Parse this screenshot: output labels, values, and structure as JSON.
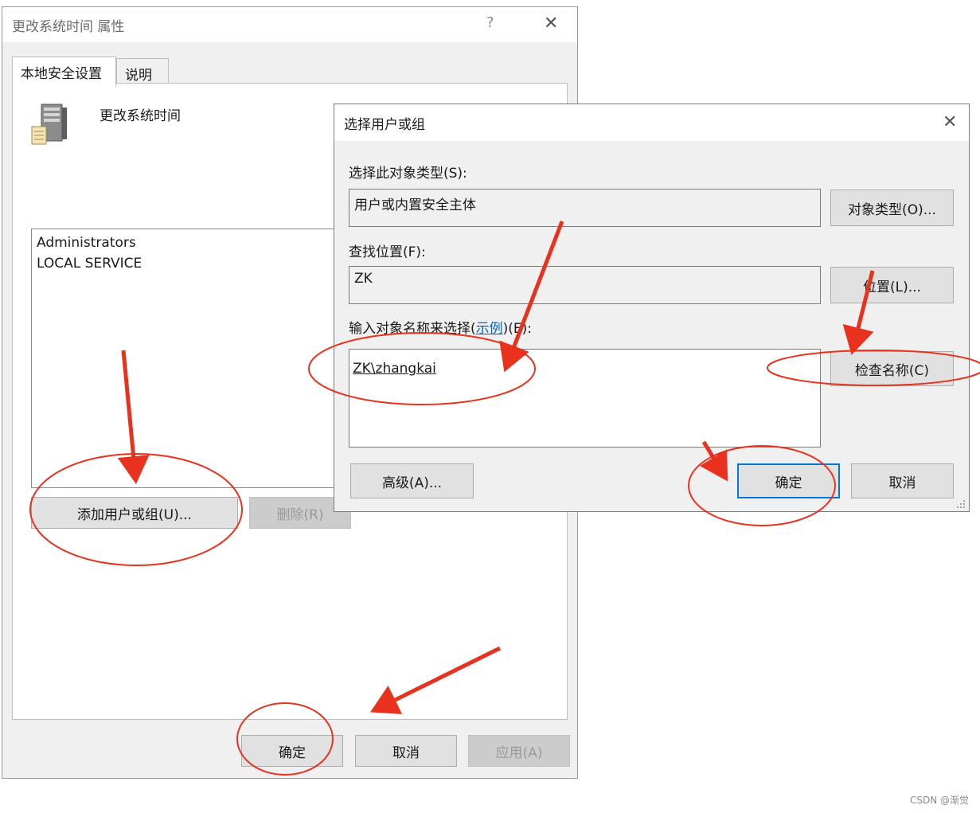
{
  "outer_dialog": {
    "title": "更改系统时间 属性",
    "help_label": "?",
    "tabs": [
      {
        "label": "本地安全设置",
        "active": true
      },
      {
        "label": "说明",
        "active": false
      }
    ],
    "policy_name": "更改系统时间",
    "accounts": [
      "Administrators",
      "LOCAL SERVICE"
    ],
    "add_button": "添加用户或组(U)...",
    "remove_button": "删除(R)",
    "ok_button": "确定",
    "cancel_button": "取消",
    "apply_button": "应用(A)"
  },
  "select_dialog": {
    "title": "选择用户或组",
    "object_type_label": "选择此对象类型(S):",
    "object_type_value": "用户或内置安全主体",
    "object_types_button": "对象类型(O)...",
    "location_label": "查找位置(F):",
    "location_value": "ZK",
    "locations_button": "位置(L)...",
    "enter_names_label_pre": "输入对象名称来选择(",
    "examples_link": "示例",
    "enter_names_label_post": ")(E):",
    "entered_name": "ZK\\zhangkai",
    "check_names_button": "检查名称(C)",
    "advanced_button": "高级(A)...",
    "ok_button": "确定",
    "cancel_button": "取消"
  },
  "annotation_color": "#e8321e",
  "watermark": "CSDN @渐觉"
}
